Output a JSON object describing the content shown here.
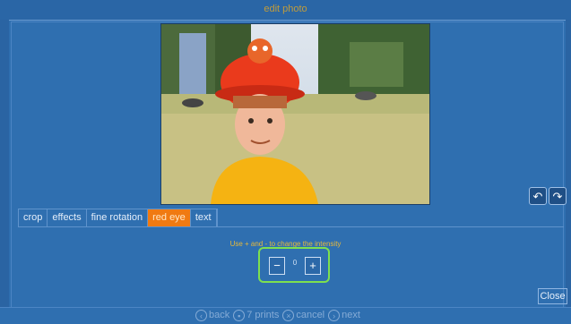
{
  "window": {
    "title": "edit photo"
  },
  "tabs": [
    {
      "label": "crop"
    },
    {
      "label": "effects"
    },
    {
      "label": "fine rotation"
    },
    {
      "label": "red eye"
    },
    {
      "label": "text"
    }
  ],
  "active_tab": "red eye",
  "redeye": {
    "instruction": "Use + and - to change the intensity",
    "minus_label": "−",
    "plus_label": "+",
    "value": "0"
  },
  "rotate": {
    "left_icon": "rotate-left-icon",
    "right_icon": "rotate-right-icon"
  },
  "close_label": "Close",
  "bottom_nav": {
    "back": "back",
    "prints": "7 prints",
    "cancel": "cancel",
    "next": "next"
  },
  "colors": {
    "accent": "#f07a12",
    "background": "#2f6fb0",
    "highlight": "#7ee04f",
    "instruction": "#e6b93b"
  }
}
